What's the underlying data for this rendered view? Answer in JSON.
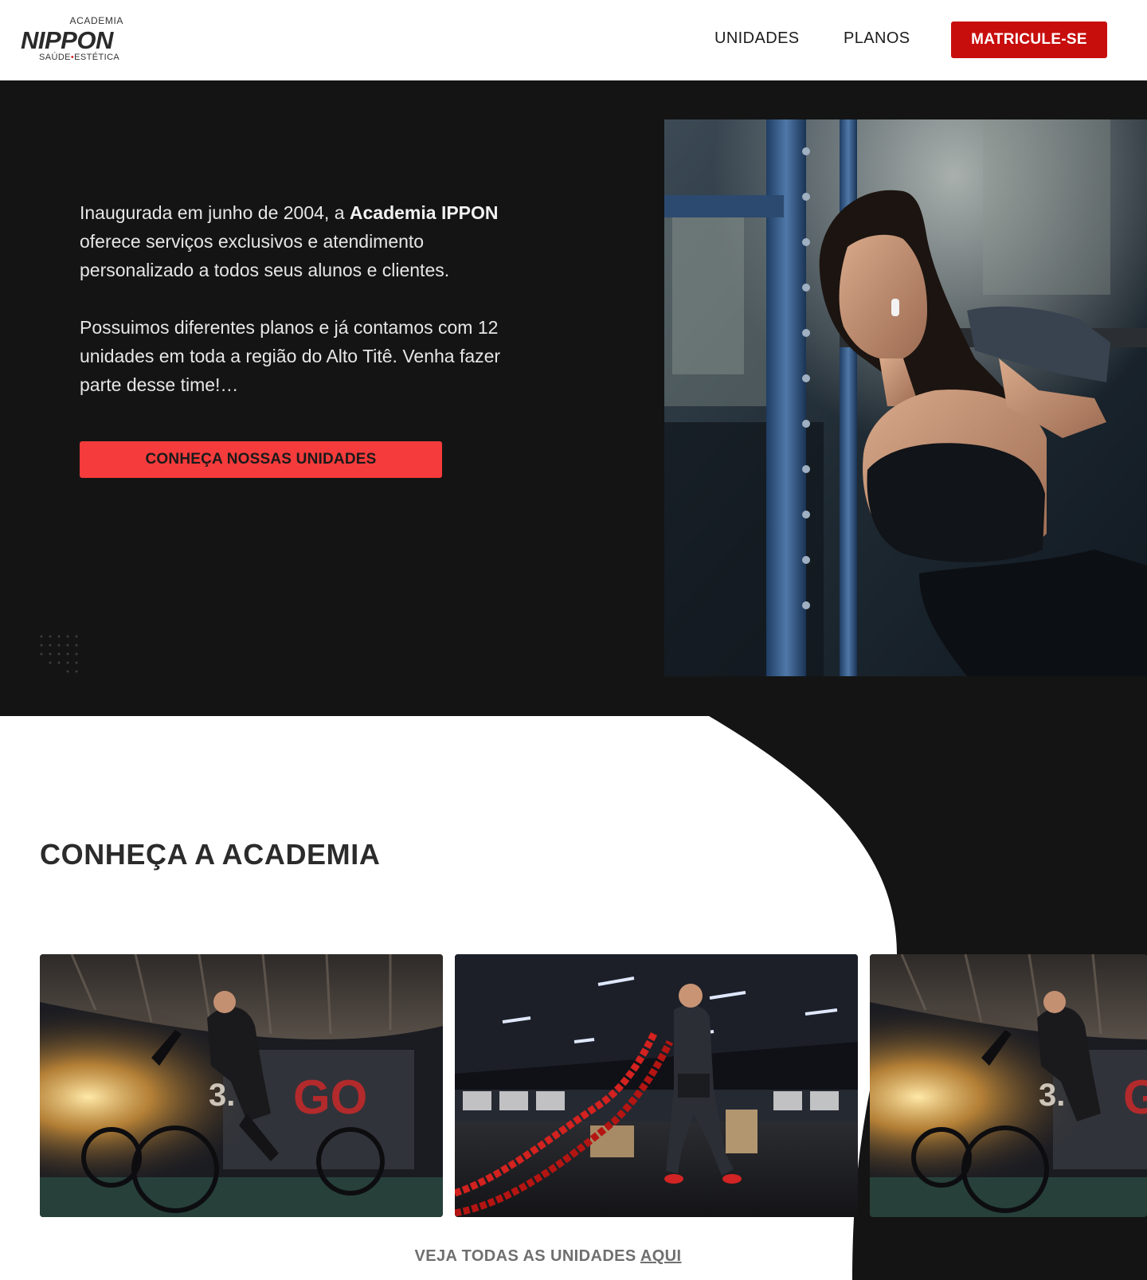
{
  "header": {
    "logo": {
      "top_text": "ACADEMIA",
      "brand": "NIPPON",
      "sub_left": "SAÚDE",
      "sub_dot": "•",
      "sub_right": "ESTÉTICA"
    },
    "nav": [
      {
        "label": "UNIDADES"
      },
      {
        "label": "PLANOS"
      }
    ],
    "cta_label": "MATRICULE-SE"
  },
  "hero": {
    "paragraph1_prefix": "Inaugurada em junho de 2004, a ",
    "paragraph1_bold": "Academia IPPON",
    "paragraph1_suffix": " oferece serviços exclusivos e atendimento personalizado a todos seus alunos e clientes.",
    "paragraph2": "Possuimos diferentes planos e já contamos com 12 unidades em toda a região do Alto Titê. Venha fazer parte desse time!…",
    "button_label": "CONHEÇA NOSSAS UNIDADES",
    "photo_icon": "woman-squat-photo"
  },
  "section": {
    "title": "CONHEÇA A ACADEMIA",
    "gallery": [
      {
        "icon": "woman-air-bike-photo"
      },
      {
        "icon": "man-battle-ropes-photo"
      },
      {
        "icon": "woman-air-bike-photo"
      }
    ],
    "see_all_text": "VEJA TODAS AS UNIDADES ",
    "see_all_link": "AQUI"
  },
  "colors": {
    "header_cta": "#c80d0d",
    "hero_bg": "#141414",
    "hero_button": "#f53b3b",
    "logo_dot": "#e02020"
  }
}
